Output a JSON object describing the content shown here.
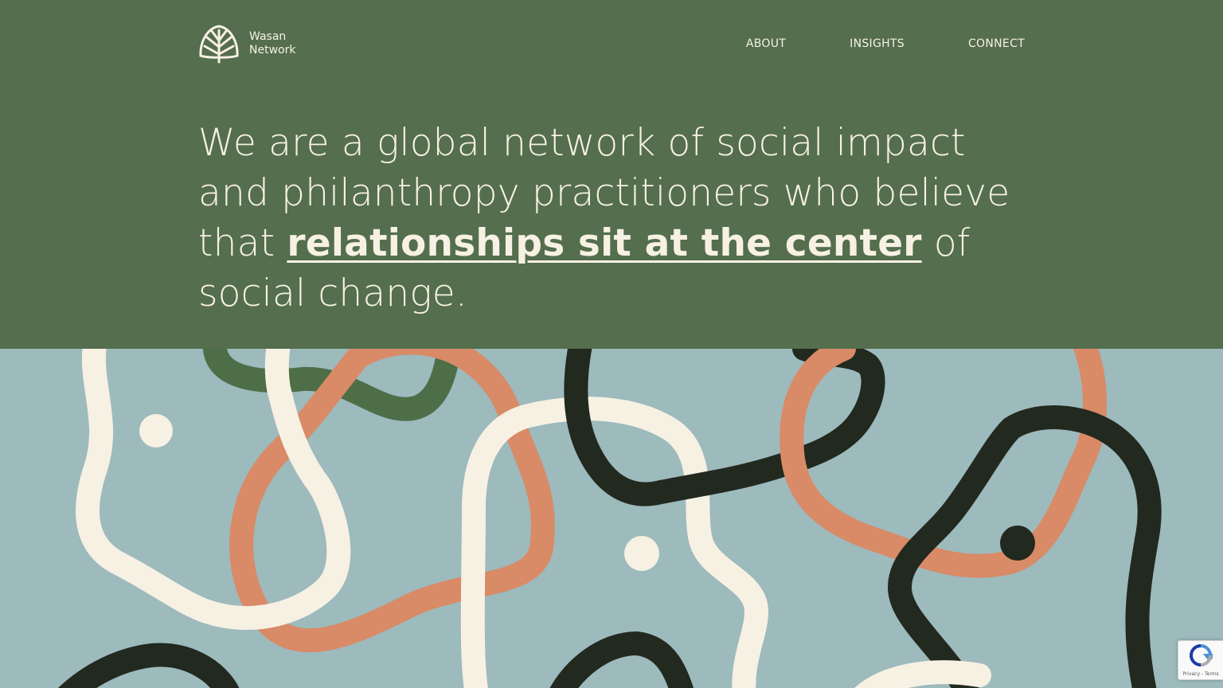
{
  "brand": {
    "line1": "Wasan",
    "line2": "Network"
  },
  "nav": {
    "items": [
      "ABOUT",
      "INSIGHTS",
      "CONNECT"
    ]
  },
  "hero": {
    "text_before": "We are a global network of social impact and philanthropy practitioners who believe that ",
    "link_text": "relationships sit at the center",
    "text_after": " of social change."
  },
  "recaptcha": {
    "links": "Privacy - Terms"
  },
  "colors": {
    "header_bg": "#546e4e",
    "art_bg": "#9dbabd",
    "cream": "#f7f1e3",
    "terracotta": "#d98a66",
    "dark": "#22291f",
    "green": "#4d6e47"
  },
  "icons": {
    "logo": "tree-leaf-icon",
    "recaptcha": "recaptcha-icon"
  }
}
